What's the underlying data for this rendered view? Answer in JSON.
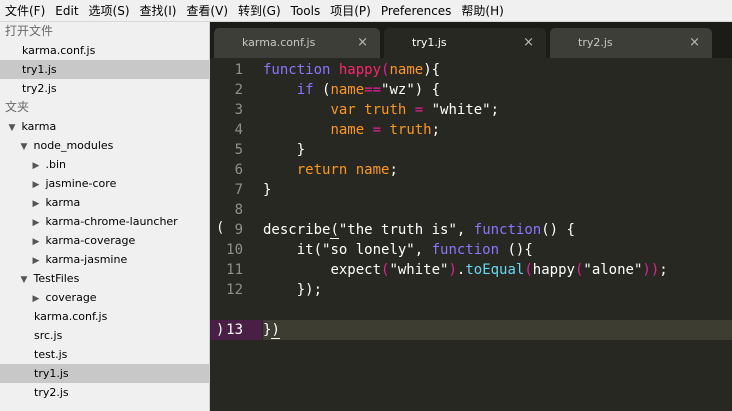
{
  "menubar": {
    "items": [
      "文件(F)",
      "Edit",
      "选项(S)",
      "查找(I)",
      "查看(V)",
      "转到(G)",
      "Tools",
      "项目(P)",
      "Preferences",
      "帮助(H)"
    ]
  },
  "sidebar": {
    "open_files_header": "打开文件",
    "open_files": [
      "karma.conf.js",
      "try1.js",
      "try2.js"
    ],
    "folders_header": "文夹",
    "tree": {
      "root": "karma",
      "node_modules": "node_modules",
      "node_modules_children": [
        ".bin",
        "jasmine-core",
        "karma",
        "karma-chrome-launcher",
        "karma-coverage",
        "karma-jasmine"
      ],
      "testfiles": "TestFiles",
      "coverage": "coverage",
      "files": [
        "karma.conf.js",
        "src.js",
        "test.js",
        "try1.js",
        "try2.js"
      ]
    }
  },
  "tabs": [
    {
      "label": "karma.conf.js",
      "close": "×"
    },
    {
      "label": "try1.js",
      "close": "×"
    },
    {
      "label": "try2.js",
      "close": "×"
    }
  ],
  "gutter": {
    "line_numbers": [
      "1",
      "2",
      "3",
      "4",
      "5",
      "6",
      "7",
      "8",
      "9",
      "10",
      "11",
      "12",
      "13"
    ],
    "bracket_open": "(",
    "bracket_close": ")"
  },
  "colors": {
    "editor_bg": "#272822",
    "keyword": "#66d9ef",
    "string": "#e6db74",
    "function": "#a6e22e",
    "param": "#fd971f"
  }
}
